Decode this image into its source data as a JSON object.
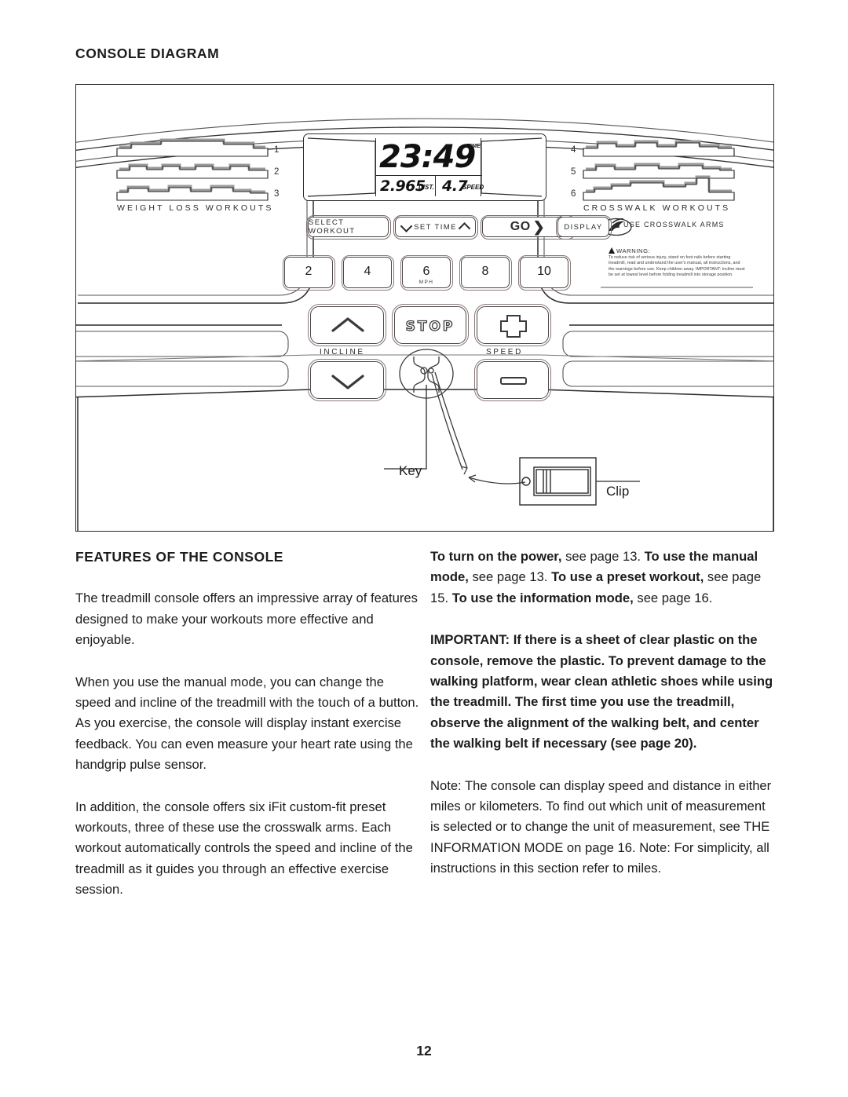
{
  "document": {
    "section_title": "CONSOLE DIAGRAM",
    "page_number": "12"
  },
  "console": {
    "display": {
      "time_value": "23:49",
      "time_label": "TIME",
      "distance_value": "2.965",
      "distance_label": "DIST.",
      "speed_value": "4.7",
      "speed_label": "SPEED"
    },
    "weight_loss_group_label": "WEIGHT LOSS WORKOUTS",
    "crosswalk_group_label": "CROSSWALK WORKOUTS",
    "workout_keys": [
      {
        "number": "1"
      },
      {
        "number": "2"
      },
      {
        "number": "3"
      },
      {
        "number": "4"
      },
      {
        "number": "5"
      },
      {
        "number": "6"
      }
    ],
    "buttons": {
      "select_workout": "SELECT WORKOUT",
      "set_time": "SET TIME",
      "go": "GO",
      "display": "DISPLAY"
    },
    "crosswalk_arms_note": "USE CROSSWALK ARMS",
    "speed_keys": [
      {
        "value": "2",
        "unit": ""
      },
      {
        "value": "4",
        "unit": ""
      },
      {
        "value": "6",
        "unit": "MPH"
      },
      {
        "value": "8",
        "unit": ""
      },
      {
        "value": "10",
        "unit": ""
      }
    ],
    "controls": {
      "stop": "STOP",
      "incline_label": "INCLINE",
      "speed_label": "SPEED"
    },
    "warning": {
      "heading": "WARNING:",
      "body": "To reduce risk of serious injury, stand on foot rails before starting treadmill, read and understand the user's manual, all instructions, and the warnings before use. Keep children away. IMPORTANT: Incline must be set at lowest level before folding treadmill into storage position."
    },
    "callouts": {
      "key": "Key",
      "clip": "Clip"
    }
  },
  "features": {
    "heading": "FEATURES OF THE CONSOLE",
    "paragraph_1": "The treadmill console offers an impressive array of features designed to make your workouts more effective and enjoyable.",
    "paragraph_2": "When you use the manual mode, you can change the speed and incline of the treadmill with the touch of a button. As you exercise, the console will display instant exercise feedback. You can even measure your heart rate using the handgrip pulse sensor.",
    "paragraph_3": "In addition, the console offers six iFit custom-fit preset workouts, three of these use the crosswalk arms. Each workout automatically controls the speed and incline of the treadmill as it guides you through an effective exercise session."
  },
  "right_column": {
    "refs": {
      "b1": "To turn on the power,",
      "t1": " see page 13. ",
      "b2": "To use the manual mode,",
      "t2": " see page 13. ",
      "b3": "To use a preset workout,",
      "t3": " see page 15. ",
      "b4": "To use the information mode,",
      "t4": " see page 16."
    },
    "important": "IMPORTANT: If there is a sheet of clear plastic on the console, remove the plastic. To prevent damage to the walking platform, wear clean athletic shoes while using the treadmill. The first time you use the treadmill, observe the alignment of the walking belt, and center the walking belt if necessary (see page 20).",
    "note": "Note: The console can display speed and distance in either miles or kilometers. To find out which unit of measurement is selected or to change the unit of measurement, see THE INFORMATION MODE on page 16. Note: For simplicity, all instructions in this section refer to miles."
  }
}
